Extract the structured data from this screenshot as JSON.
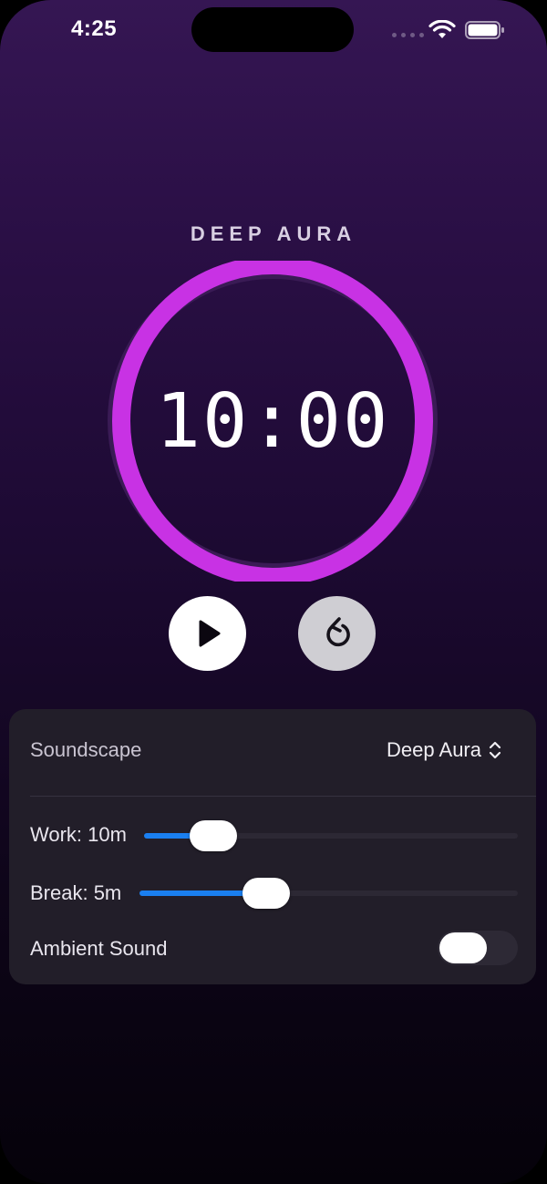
{
  "status_bar": {
    "time": "4:25"
  },
  "title": "DEEP AURA",
  "timer": {
    "display": "10:00",
    "progress": 1.0,
    "ring_color": "#c832e4"
  },
  "controls": {
    "play_icon": "play-icon",
    "reset_icon": "reset-icon"
  },
  "settings": {
    "soundscape_label": "Soundscape",
    "soundscape_value": "Deep Aura",
    "work_label": "Work: 10m",
    "work_value": 0.14,
    "break_label": "Break: 5m",
    "break_value": 0.31,
    "ambient_label": "Ambient Sound",
    "ambient_on": false,
    "accent_color": "#1a7ff0"
  }
}
